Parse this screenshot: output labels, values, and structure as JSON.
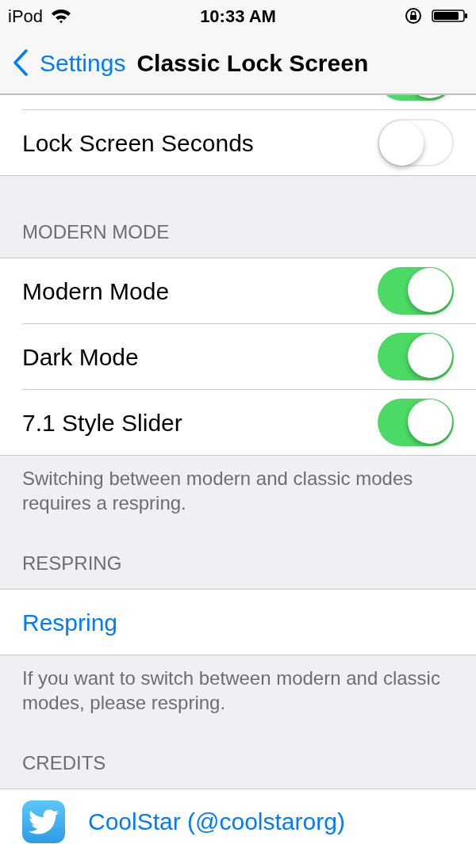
{
  "status_bar": {
    "carrier": "iPod",
    "time": "10:33 AM"
  },
  "nav": {
    "back": "Settings",
    "title": "Classic Lock Screen"
  },
  "sections": [
    {
      "rows": [
        {
          "kind": "toggle_partial",
          "on": true
        },
        {
          "kind": "toggle",
          "label": "Lock Screen Seconds",
          "on": false
        }
      ]
    },
    {
      "header": "MODERN MODE",
      "rows": [
        {
          "kind": "toggle",
          "label": "Modern Mode",
          "on": true
        },
        {
          "kind": "toggle",
          "label": "Dark Mode",
          "on": true
        },
        {
          "kind": "toggle",
          "label": "7.1 Style Slider",
          "on": true
        }
      ],
      "footer": "Switching between modern and classic modes requires a respring."
    },
    {
      "header": "RESPRING",
      "rows": [
        {
          "kind": "link",
          "label": "Respring"
        }
      ],
      "footer": "If you want to switch between modern and classic modes, please respring."
    },
    {
      "header": "CREDITS",
      "rows": [
        {
          "kind": "credit",
          "label": "CoolStar (@coolstarorg)"
        }
      ]
    }
  ]
}
